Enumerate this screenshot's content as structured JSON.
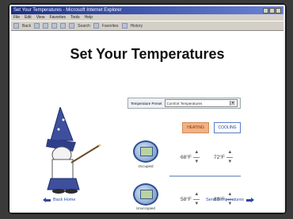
{
  "browser": {
    "title": "Set Your Temperatures - Microsoft Internet Explorer",
    "menu": [
      "File",
      "Edit",
      "View",
      "Favorites",
      "Tools",
      "Help"
    ],
    "toolbar": [
      "Back",
      "Search",
      "Favorites",
      "History"
    ]
  },
  "page": {
    "title": "Set Your Temperatures",
    "schedule_label": "Temperature Preset",
    "schedule_value": "Comfort Temperatures",
    "heating_label": "HEATING",
    "cooling_label": "COOLING",
    "occupied_label": "Occupied",
    "unoccupied_label": "Unoccupied",
    "occupied_heat": "68°F",
    "occupied_cool": "72°F",
    "unoccupied_heat": "58°F",
    "unoccupied_cool": "88°F",
    "back_label": "Back Home",
    "send_label": "Send Temperatures"
  },
  "colors": {
    "heating": "#f4b183",
    "cooling": "#5a7cc0",
    "link": "#2a4aa0"
  }
}
